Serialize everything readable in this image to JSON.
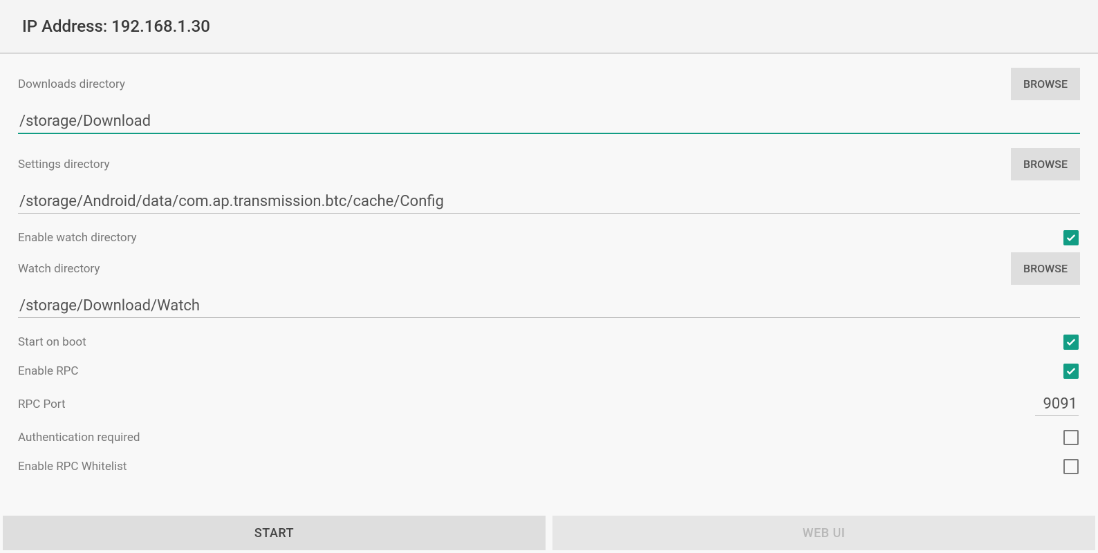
{
  "header": {
    "title": "IP Address: 192.168.1.30"
  },
  "fields": {
    "downloads_dir_label": "Downloads directory",
    "downloads_dir_value": "/storage/Download",
    "settings_dir_label": "Settings directory",
    "settings_dir_value": "/storage/Android/data/com.ap.transmission.btc/cache/Config",
    "enable_watch_label": "Enable watch directory",
    "enable_watch_value": true,
    "watch_dir_label": "Watch directory",
    "watch_dir_value": "/storage/Download/Watch",
    "start_on_boot_label": "Start on boot",
    "start_on_boot_value": true,
    "enable_rpc_label": "Enable RPC",
    "enable_rpc_value": true,
    "rpc_port_label": "RPC Port",
    "rpc_port_value": "9091",
    "auth_required_label": "Authentication required",
    "auth_required_value": false,
    "enable_rpc_whitelist_label": "Enable RPC Whitelist",
    "enable_rpc_whitelist_value": false
  },
  "buttons": {
    "browse": "BROWSE",
    "start": "START",
    "web_ui": "WEB UI"
  },
  "colors": {
    "accent": "#129d84"
  }
}
